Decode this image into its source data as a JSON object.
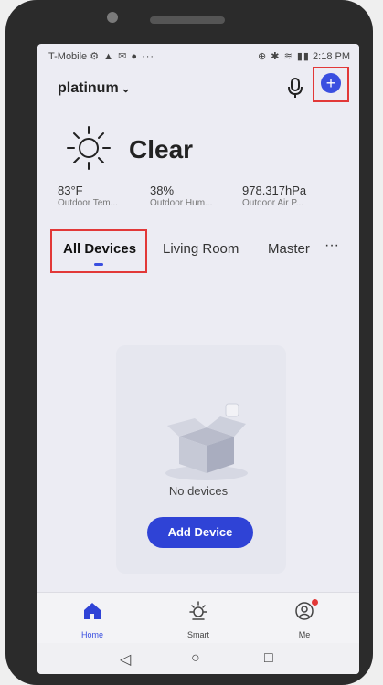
{
  "status_bar": {
    "carrier": "T-Mobile",
    "left_glyphs": "⚙ ▲ ✉ ● ···",
    "right_glyphs": "⊕ ✱ ≋ ▮▮",
    "time": "2:18 PM"
  },
  "header": {
    "home_name": "platinum",
    "chevron": "⌄",
    "add_symbol": "+",
    "mic_icon": "microphone-icon"
  },
  "weather": {
    "condition": "Clear",
    "icon": "sun-icon",
    "metrics": [
      {
        "value": "83°F",
        "label": "Outdoor Tem..."
      },
      {
        "value": "38%",
        "label": "Outdoor Hum..."
      },
      {
        "value": "978.317hPa",
        "label": "Outdoor Air P..."
      }
    ]
  },
  "tabs": [
    {
      "label": "All Devices"
    },
    {
      "label": "Living Room"
    },
    {
      "label": "Master"
    }
  ],
  "more_symbol": "···",
  "empty_state": {
    "text": "No devices",
    "button": "Add Device"
  },
  "bottom_nav": [
    {
      "label": "Home",
      "icon": "home-icon"
    },
    {
      "label": "Smart",
      "icon": "sun-icon"
    },
    {
      "label": "Me",
      "icon": "profile-icon"
    }
  ],
  "system_nav": {
    "back": "◁",
    "home": "○",
    "recents": "□"
  },
  "colors": {
    "accent": "#3a4fe0",
    "highlight": "#e23838",
    "screen_bg": "#ececf3"
  }
}
